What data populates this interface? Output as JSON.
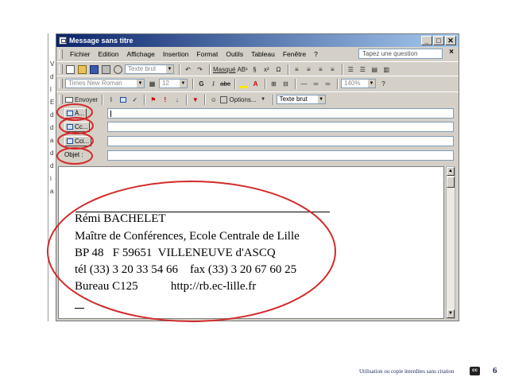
{
  "window": {
    "title": "Message sans titre",
    "controls": [
      "_",
      "□",
      "✕"
    ]
  },
  "background_strip_glyphs": [
    "V",
    "d",
    "l",
    "E",
    "d",
    "d",
    "a",
    "d",
    "d",
    "i",
    "a"
  ],
  "menubar": {
    "items": [
      "Fichier",
      "Edition",
      "Affichage",
      "Insertion",
      "Format",
      "Outils",
      "Tableau",
      "Fenêtre",
      "?"
    ],
    "help_placeholder": "Tapez une question",
    "close_glyph": "×"
  },
  "toolbar_standard": {
    "style_value": "Texte brut",
    "masque_label": "Masqué",
    "abbr_label": "AB¹",
    "section_glyph": "§",
    "x2_glyph": "x²",
    "omega_glyph": "Ω"
  },
  "toolbar_format": {
    "font_value": "Times New Roman",
    "size_value": "12",
    "bold": "G",
    "italic": "I",
    "abc_label": "abc",
    "zoom_value": "140%"
  },
  "toolbar_mail": {
    "send_label": "Envoyer",
    "options_label": "Options...",
    "format_value": "Texte brut"
  },
  "fields": [
    {
      "label": "À...",
      "value": ""
    },
    {
      "label": "Cc...",
      "value": ""
    },
    {
      "label": "Cci...",
      "value": ""
    },
    {
      "label": "Objet :",
      "value": ""
    }
  ],
  "signature": [
    "Rémi BACHELET",
    "Maître de Conférences, Ecole Centrale de Lille",
    "BP 48   F 59651  VILLENEUVE d'ASCQ",
    "tél (33) 3 20 33 54 66    fax (33) 3 20 67 60 25",
    "Bureau C125           http://rb.ec-lille.fr"
  ],
  "scroll_arrows": {
    "up": "▲",
    "down": "▼"
  },
  "footer": {
    "notice": "Utilisation ou copie interdites sans citation",
    "badge": "cc",
    "page_number": "6"
  },
  "colors": {
    "annotation_red": "#d42a2a",
    "titlebar_start": "#0a246a",
    "titlebar_end": "#a6caf0",
    "footer_text": "#1a2a5c"
  }
}
